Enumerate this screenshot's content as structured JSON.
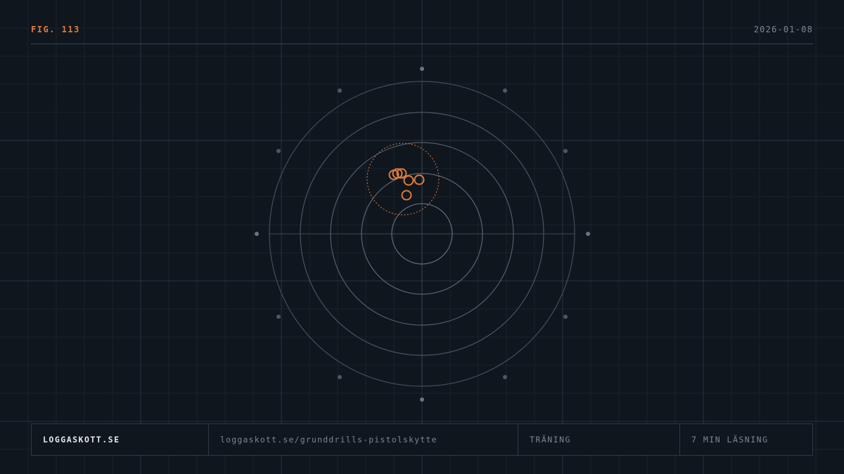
{
  "header": {
    "figure_label": "FIG. 113",
    "date": "2026-01-08"
  },
  "target": {
    "ring_count": 5,
    "ring_color": "#5b6470",
    "shot_color": "#e07b3c",
    "icons": [
      "target-icon",
      "shot-hole-icon",
      "group-circle-icon"
    ]
  },
  "footer": {
    "site": "LOGGASKOTT.SE",
    "url": "loggaskott.se/grunddrills-pistolskytte",
    "category": "TRÄNING",
    "read_time": "7 MIN LÄSNING"
  },
  "colors": {
    "background": "#0f161e",
    "accent": "#e07b3c",
    "muted_text": "#7c8692",
    "primary_text": "#e3e8ee"
  }
}
